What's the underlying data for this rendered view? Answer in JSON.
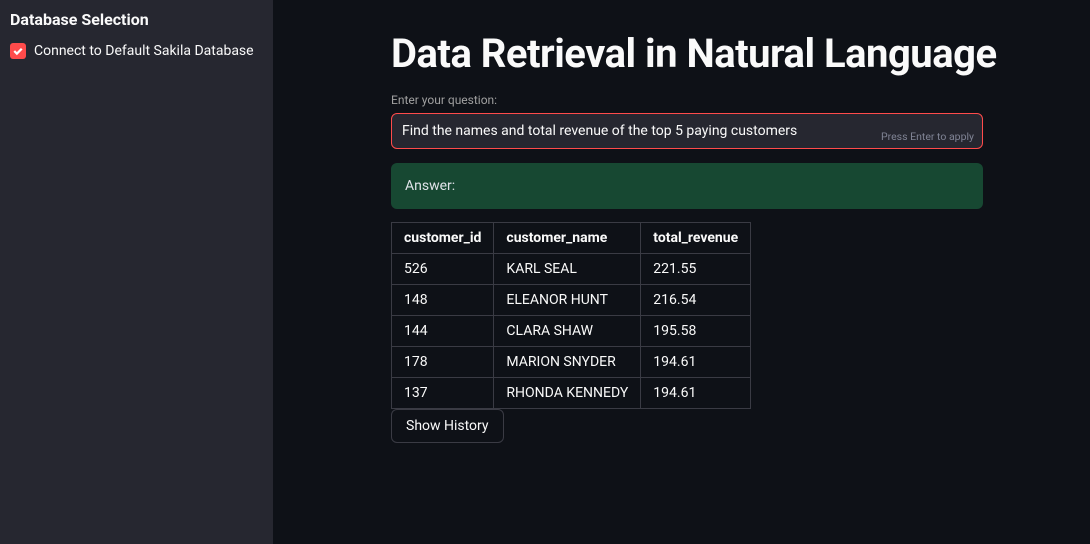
{
  "sidebar": {
    "title": "Database Selection",
    "checkbox_label": "Connect to Default Sakila Database",
    "checked": true
  },
  "main": {
    "title": "Data Retrieval in Natural Language",
    "input_label": "Enter your question:",
    "input_value": "Find the names and total revenue of the top 5 paying customers",
    "input_hint": "Press Enter to apply",
    "answer_label": "Answer:",
    "history_button": "Show History"
  },
  "table": {
    "columns": [
      "customer_id",
      "customer_name",
      "total_revenue"
    ],
    "rows": [
      {
        "customer_id": "526",
        "customer_name": "KARL SEAL",
        "total_revenue": "221.55"
      },
      {
        "customer_id": "148",
        "customer_name": "ELEANOR HUNT",
        "total_revenue": "216.54"
      },
      {
        "customer_id": "144",
        "customer_name": "CLARA SHAW",
        "total_revenue": "195.58"
      },
      {
        "customer_id": "178",
        "customer_name": "MARION SNYDER",
        "total_revenue": "194.61"
      },
      {
        "customer_id": "137",
        "customer_name": "RHONDA KENNEDY",
        "total_revenue": "194.61"
      }
    ]
  }
}
